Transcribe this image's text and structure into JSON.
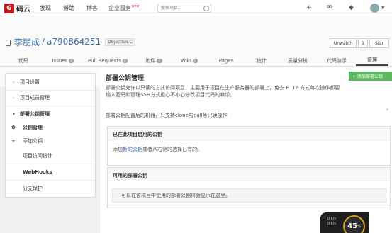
{
  "navbar": {
    "logo_text": "码云",
    "links": [
      "发现",
      "帮助",
      "博客",
      "企业服务"
    ],
    "enterprise_badge": "new",
    "search_placeholder": "搜索项目...",
    "icons": [
      "plus-icon",
      "mail-icon",
      "bell-icon",
      "avatar",
      "chevron-down-icon"
    ]
  },
  "repo": {
    "owner": "李朋成",
    "name": "a790864251",
    "language": "Objective-C",
    "watch_label": "Unwatch",
    "watch_count": "1",
    "star_label": "Star"
  },
  "tabs": [
    {
      "label": "代码",
      "count": ""
    },
    {
      "label": "Issues",
      "count": "0"
    },
    {
      "label": "Pull Requests",
      "count": "0"
    },
    {
      "label": "附件",
      "count": "0"
    },
    {
      "label": "Wiki",
      "count": "0"
    },
    {
      "label": "Pages",
      "count": ""
    },
    {
      "label": "统计",
      "count": ""
    },
    {
      "label": "质量分析",
      "count": ""
    },
    {
      "label": "代码演示",
      "count": ""
    },
    {
      "label": "管理",
      "count": ""
    }
  ],
  "sidebar": {
    "items": [
      {
        "label": "项目设置"
      },
      {
        "label": "项目成员管理"
      },
      {
        "label": "部署公钥管理"
      },
      {
        "label": "公钥管理"
      },
      {
        "label": "添加公钥"
      },
      {
        "label": "项目访问统计"
      },
      {
        "label": "WebHooks"
      },
      {
        "label": "分支保护"
      }
    ]
  },
  "main": {
    "title": "部署公钥管理",
    "add_button": "+ 添加部署公钥",
    "description_line1": "部署公钥允许以只读的方式访问项目，主要用于项目在生产服务器的部署上，免去 HTTP 方式每次操作都要",
    "description_line2": "输入密码和管理SSH方式担心不小心修改项目代码的麻烦。",
    "note": "部署公钥配置后的机器，只支持clone与pull等只读操作",
    "enabled_panel": {
      "title": "已在此项目启用的公钥",
      "body_prefix": "添加",
      "body_link": "新的公钥",
      "body_suffix": "或者从右侧的选择已有的。"
    },
    "available_panel": {
      "title": "可用的部署公钥",
      "body": "可以在该项目中使用的部署公钥将会显示在这里。"
    }
  },
  "widget": {
    "line1": "0 k/s",
    "line2": "0 k/s",
    "percent": "45",
    "percent_unit": "%"
  }
}
